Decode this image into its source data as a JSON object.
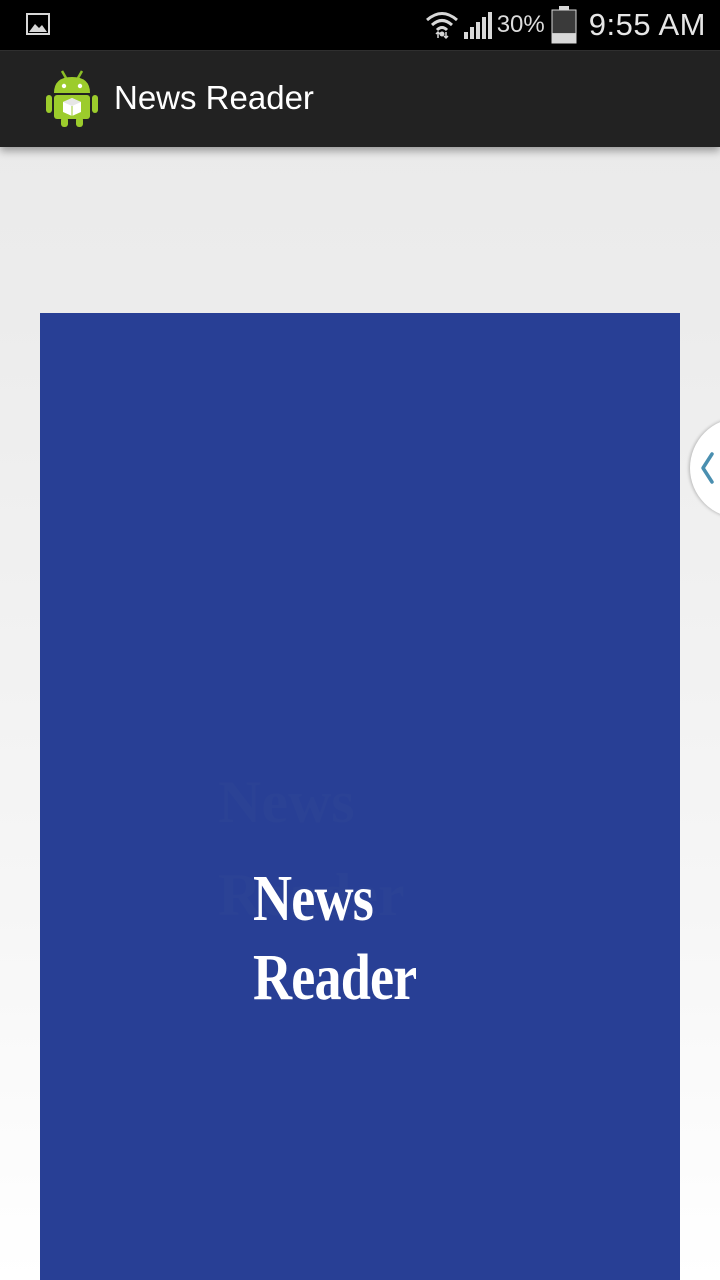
{
  "status_bar": {
    "notification_icon": "image-notification-icon",
    "wifi_icon": "wifi-icon",
    "signal_icon": "cell-signal-icon",
    "battery_percent": "30%",
    "battery_level": 0.3,
    "battery_icon": "battery-icon",
    "time": "9:55 AM"
  },
  "action_bar": {
    "app_icon": "android-robot-icon",
    "title": "News Reader"
  },
  "splash": {
    "background_color": "#283f95",
    "logo_line_1": "News",
    "logo_line_2": "Reader"
  },
  "side_handle": {
    "icon": "chevron-left-icon",
    "accent_color": "#4a8fb0"
  }
}
